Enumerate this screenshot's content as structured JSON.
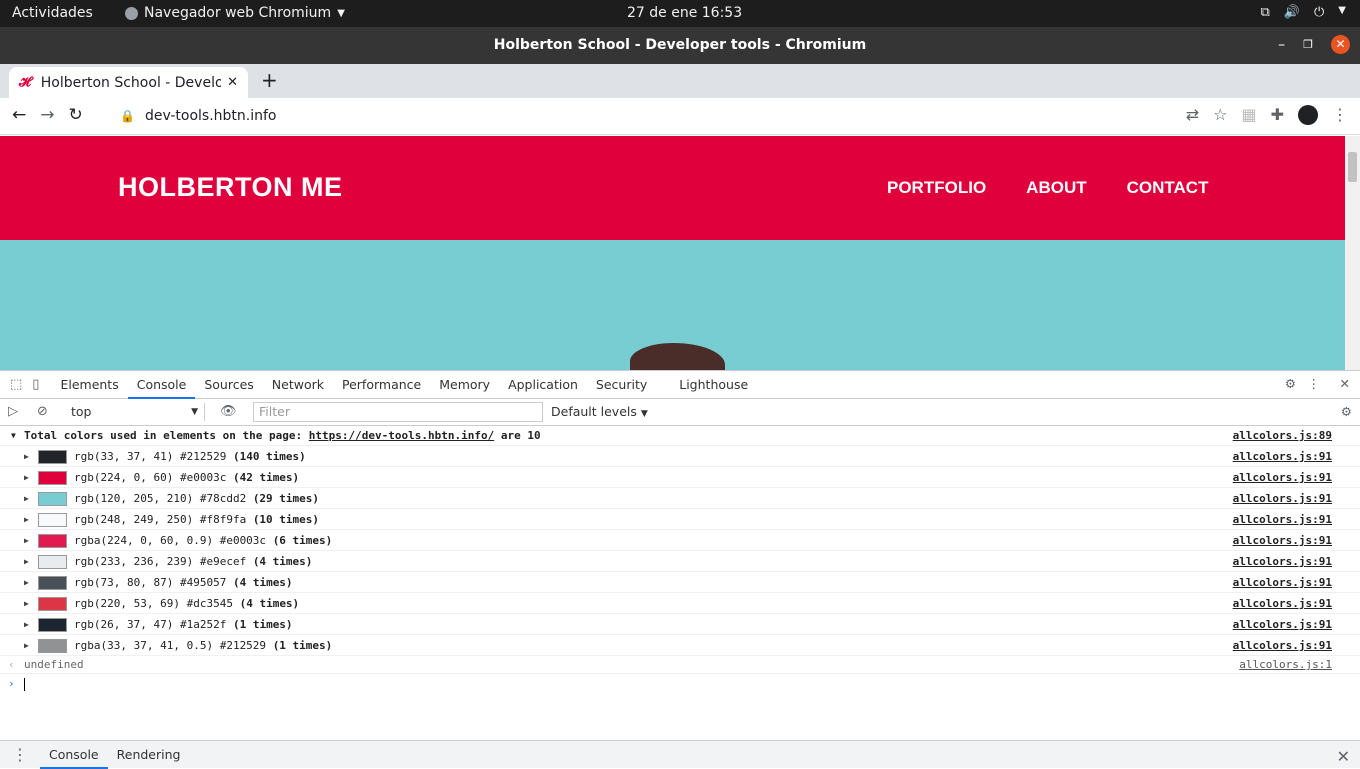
{
  "system": {
    "activities": "Actividades",
    "app_menu": "Navegador web Chromium",
    "clock": "27 de ene  16:53"
  },
  "window": {
    "title": "Holberton School - Developer tools - Chromium",
    "close_glyph": "✕"
  },
  "browser": {
    "tab_title": "Holberton School - Developer tools",
    "new_tab": "+",
    "url": "dev-tools.hbtn.info"
  },
  "site": {
    "brand": "HOLBERTON ME",
    "nav": [
      "PORTFOLIO",
      "ABOUT",
      "CONTACT"
    ],
    "header_color": "#e0003c",
    "hero_color": "#78cdd2"
  },
  "devtools": {
    "tabs": [
      "Elements",
      "Console",
      "Sources",
      "Network",
      "Performance",
      "Memory",
      "Application",
      "Security",
      "Lighthouse"
    ],
    "active_tab": "Console",
    "context": "top",
    "filter_placeholder": "Filter",
    "levels": "Default levels",
    "summary_prefix": "Total colors used in elements on the page:",
    "summary_url": "https://dev-tools.hbtn.info/",
    "summary_suffix": "are 10",
    "summary_source": "allcolors.js:89",
    "colors": [
      {
        "text": "rgb(33, 37, 41) #212529",
        "count": "(140 times)",
        "hex": "#212529",
        "source": "allcolors.js:91"
      },
      {
        "text": "rgb(224, 0, 60) #e0003c",
        "count": "(42 times)",
        "hex": "#e0003c",
        "source": "allcolors.js:91"
      },
      {
        "text": "rgb(120, 205, 210) #78cdd2",
        "count": "(29 times)",
        "hex": "#78cdd2",
        "source": "allcolors.js:91"
      },
      {
        "text": "rgb(248, 249, 250) #f8f9fa",
        "count": "(10 times)",
        "hex": "#f8f9fa",
        "source": "allcolors.js:91"
      },
      {
        "text": "rgba(224, 0, 60, 0.9) #e0003c",
        "count": "(6 times)",
        "hex": "#e31a50",
        "source": "allcolors.js:91"
      },
      {
        "text": "rgb(233, 236, 239) #e9ecef",
        "count": "(4 times)",
        "hex": "#e9ecef",
        "source": "allcolors.js:91"
      },
      {
        "text": "rgb(73, 80, 87) #495057",
        "count": "(4 times)",
        "hex": "#495057",
        "source": "allcolors.js:91"
      },
      {
        "text": "rgb(220, 53, 69) #dc3545",
        "count": "(4 times)",
        "hex": "#dc3545",
        "source": "allcolors.js:91"
      },
      {
        "text": "rgb(26, 37, 47) #1a252f",
        "count": "(1 times)",
        "hex": "#1a252f",
        "source": "allcolors.js:91"
      },
      {
        "text": "rgba(33, 37, 41, 0.5) #212529",
        "count": "(1 times)",
        "hex": "#909294",
        "source": "allcolors.js:91"
      }
    ],
    "return_value": "undefined",
    "return_source": "allcolors.js:1",
    "drawer_tabs": [
      "Console",
      "Rendering"
    ]
  }
}
